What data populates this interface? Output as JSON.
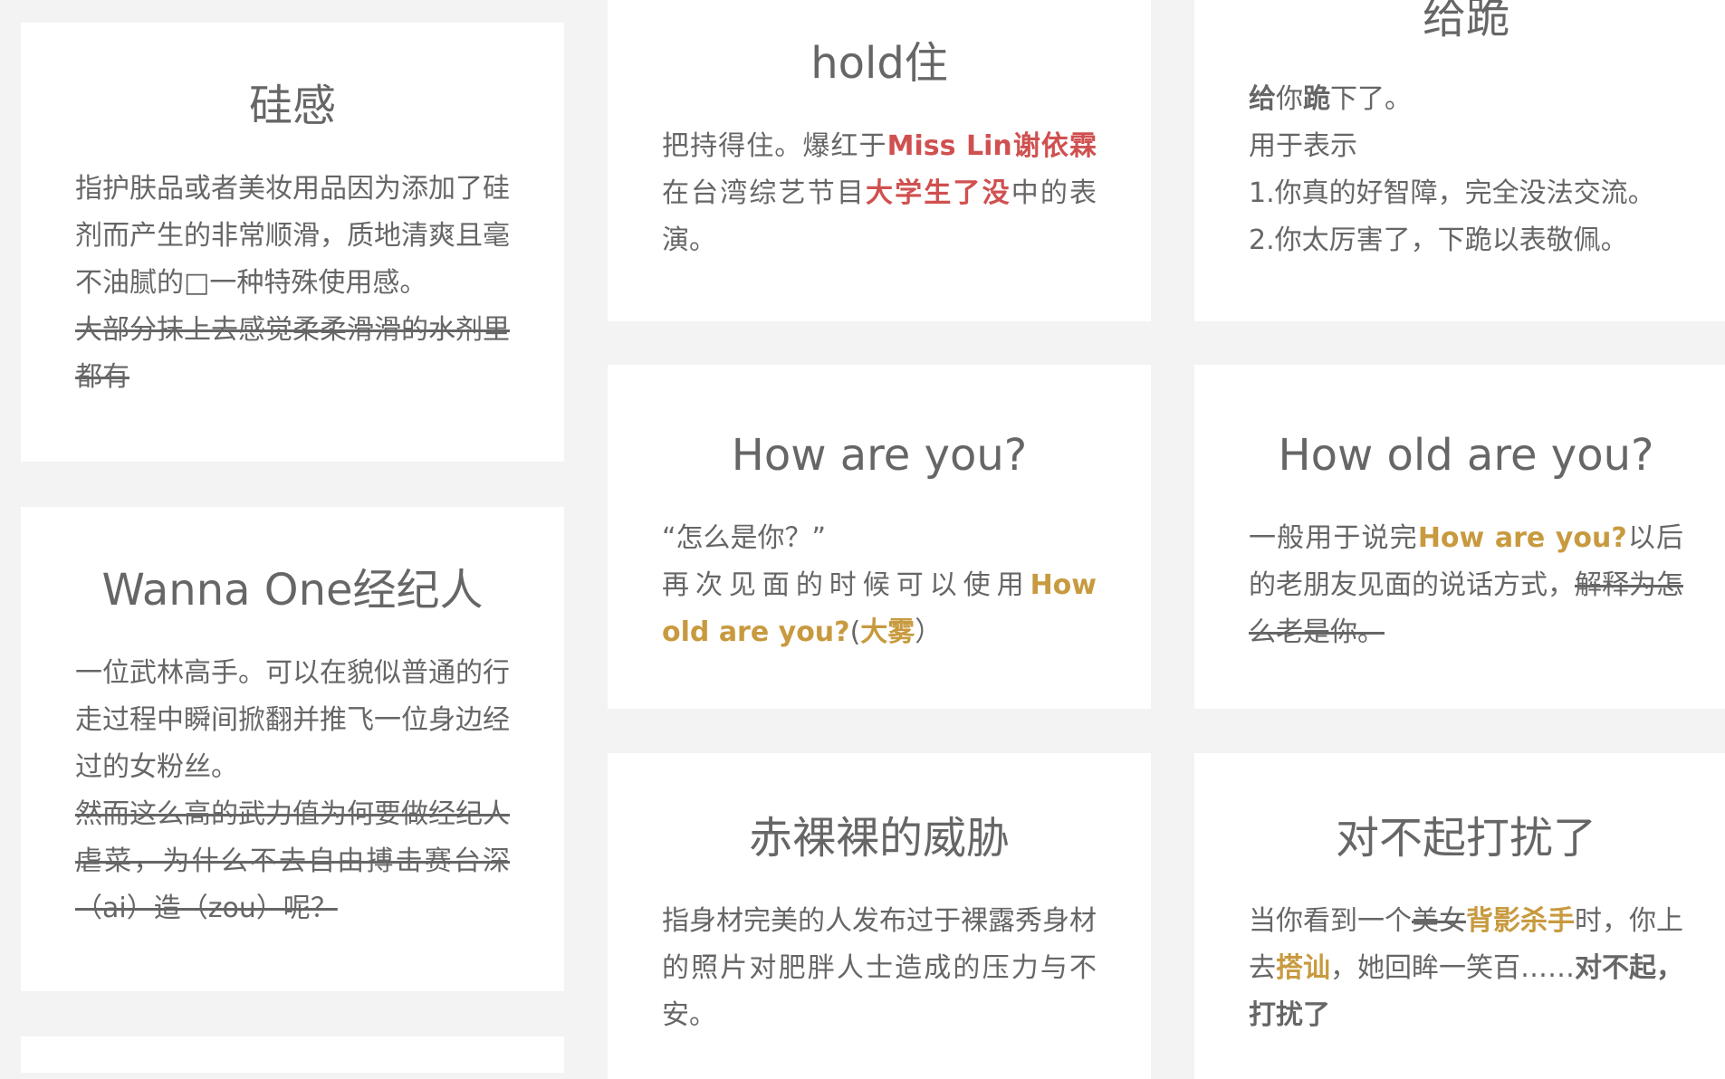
{
  "cards": {
    "silicon": {
      "title": "硅感",
      "body_1": "指护肤品或者美妆用品因为添加了硅剂而产生的非常顺滑，质地清爽且毫不油腻的",
      "body_box": "□",
      "body_2": "一种特殊使用感。",
      "strike": "大部分抹上去感觉柔柔滑滑的水剂里都有"
    },
    "hold": {
      "title": "hold住",
      "body_1": "把持得住。爆红于",
      "hl_1": "Miss Lin谢依霖",
      "body_2": "在台湾综艺节目",
      "hl_2": "大学生了没",
      "body_3": "中的表演。"
    },
    "kneel": {
      "title": "给跪",
      "bold_1": "给",
      "mid_1": "你",
      "bold_2": "跪",
      "tail_1": "下了。",
      "line_2": "用于表示",
      "line_3": "1.你真的好智障，完全没法交流。",
      "line_4": "2.你太厉害了，下跪以表敬佩。"
    },
    "wanna_one": {
      "title": "Wanna One经纪人",
      "body": "一位武林高手。可以在貌似普通的行走过程中瞬间掀翻并推飞一位身边经过的女粉丝。",
      "strike": "然而这么高的武力值为何要做经纪人虐菜，为什么不去自由搏击赛台深（ai）造（zou）呢？"
    },
    "how_are_you": {
      "title": "How are you?",
      "line_1": "“怎么是你？”",
      "line_2": "再次见面的时候可以使用",
      "hl_1": "How old are you?",
      "paren_open": "(",
      "hl_2": "大雾",
      "paren_close": "）"
    },
    "how_old": {
      "title": "How old are you?",
      "body_1": "一般用于说完",
      "hl_1": "How are you?",
      "body_2": "以后的老朋友见面的说话方式，",
      "strike": "解释为怎么老是你。"
    },
    "naked": {
      "title": "赤裸裸的威胁",
      "body": "指身材完美的人发布过于裸露秀身材的照片对肥胖人士造成的压力与不安。"
    },
    "sorry": {
      "title": "对不起打扰了",
      "body_1": "当你看到一个",
      "strike": "美女",
      "hl_1": "背影杀手",
      "body_2": "时，你上去",
      "hl_2": "搭讪",
      "body_3": "，她回眸一笑百……",
      "bold_1": "对不起，打扰了"
    }
  }
}
